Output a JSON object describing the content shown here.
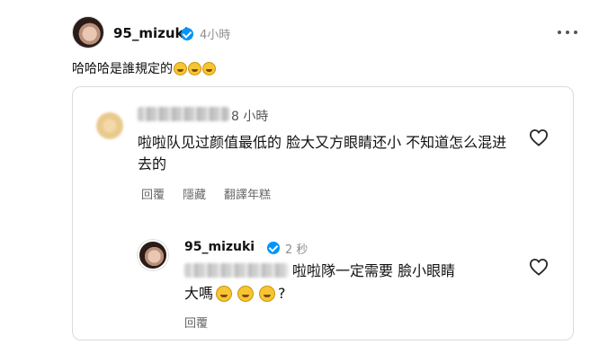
{
  "post": {
    "username": "95_mizuki",
    "time": "4小時",
    "caption": "哈哈哈是誰規定的",
    "caption_emoji": [
      "rolling-on-floor-laughing",
      "rolling-on-floor-laughing",
      "rolling-on-floor-laughing"
    ]
  },
  "comment": {
    "time": "8 小時",
    "text": "啦啦队见过颜值最低的 脸大又方眼睛还小 不知道怎么混进去的",
    "actions": [
      "回覆",
      "隱藏",
      "翻譯年糕"
    ]
  },
  "reply": {
    "username": "95_mizuki",
    "time": "2 秒",
    "text_line1": "啦啦隊一定需要 臉小眼睛",
    "text_line2_prefix": "大嗎",
    "text_line2_suffix": "?",
    "emoji": [
      "grinning-squinting-face",
      "grinning-squinting-face",
      "grinning-squinting-face"
    ],
    "reply_action": "回覆"
  },
  "colors": {
    "verified": "#0095f6",
    "secondary_text": "#8e8e8e",
    "border": "#dbdbdb"
  }
}
